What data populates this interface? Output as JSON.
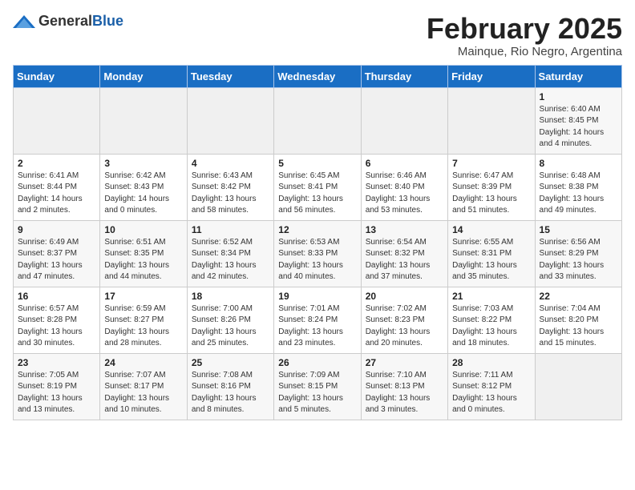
{
  "header": {
    "logo_general": "General",
    "logo_blue": "Blue",
    "month_title": "February 2025",
    "location": "Mainque, Rio Negro, Argentina"
  },
  "weekdays": [
    "Sunday",
    "Monday",
    "Tuesday",
    "Wednesday",
    "Thursday",
    "Friday",
    "Saturday"
  ],
  "weeks": [
    [
      {
        "day": "",
        "info": ""
      },
      {
        "day": "",
        "info": ""
      },
      {
        "day": "",
        "info": ""
      },
      {
        "day": "",
        "info": ""
      },
      {
        "day": "",
        "info": ""
      },
      {
        "day": "",
        "info": ""
      },
      {
        "day": "1",
        "info": "Sunrise: 6:40 AM\nSunset: 8:45 PM\nDaylight: 14 hours\nand 4 minutes."
      }
    ],
    [
      {
        "day": "2",
        "info": "Sunrise: 6:41 AM\nSunset: 8:44 PM\nDaylight: 14 hours\nand 2 minutes."
      },
      {
        "day": "3",
        "info": "Sunrise: 6:42 AM\nSunset: 8:43 PM\nDaylight: 14 hours\nand 0 minutes."
      },
      {
        "day": "4",
        "info": "Sunrise: 6:43 AM\nSunset: 8:42 PM\nDaylight: 13 hours\nand 58 minutes."
      },
      {
        "day": "5",
        "info": "Sunrise: 6:45 AM\nSunset: 8:41 PM\nDaylight: 13 hours\nand 56 minutes."
      },
      {
        "day": "6",
        "info": "Sunrise: 6:46 AM\nSunset: 8:40 PM\nDaylight: 13 hours\nand 53 minutes."
      },
      {
        "day": "7",
        "info": "Sunrise: 6:47 AM\nSunset: 8:39 PM\nDaylight: 13 hours\nand 51 minutes."
      },
      {
        "day": "8",
        "info": "Sunrise: 6:48 AM\nSunset: 8:38 PM\nDaylight: 13 hours\nand 49 minutes."
      }
    ],
    [
      {
        "day": "9",
        "info": "Sunrise: 6:49 AM\nSunset: 8:37 PM\nDaylight: 13 hours\nand 47 minutes."
      },
      {
        "day": "10",
        "info": "Sunrise: 6:51 AM\nSunset: 8:35 PM\nDaylight: 13 hours\nand 44 minutes."
      },
      {
        "day": "11",
        "info": "Sunrise: 6:52 AM\nSunset: 8:34 PM\nDaylight: 13 hours\nand 42 minutes."
      },
      {
        "day": "12",
        "info": "Sunrise: 6:53 AM\nSunset: 8:33 PM\nDaylight: 13 hours\nand 40 minutes."
      },
      {
        "day": "13",
        "info": "Sunrise: 6:54 AM\nSunset: 8:32 PM\nDaylight: 13 hours\nand 37 minutes."
      },
      {
        "day": "14",
        "info": "Sunrise: 6:55 AM\nSunset: 8:31 PM\nDaylight: 13 hours\nand 35 minutes."
      },
      {
        "day": "15",
        "info": "Sunrise: 6:56 AM\nSunset: 8:29 PM\nDaylight: 13 hours\nand 33 minutes."
      }
    ],
    [
      {
        "day": "16",
        "info": "Sunrise: 6:57 AM\nSunset: 8:28 PM\nDaylight: 13 hours\nand 30 minutes."
      },
      {
        "day": "17",
        "info": "Sunrise: 6:59 AM\nSunset: 8:27 PM\nDaylight: 13 hours\nand 28 minutes."
      },
      {
        "day": "18",
        "info": "Sunrise: 7:00 AM\nSunset: 8:26 PM\nDaylight: 13 hours\nand 25 minutes."
      },
      {
        "day": "19",
        "info": "Sunrise: 7:01 AM\nSunset: 8:24 PM\nDaylight: 13 hours\nand 23 minutes."
      },
      {
        "day": "20",
        "info": "Sunrise: 7:02 AM\nSunset: 8:23 PM\nDaylight: 13 hours\nand 20 minutes."
      },
      {
        "day": "21",
        "info": "Sunrise: 7:03 AM\nSunset: 8:22 PM\nDaylight: 13 hours\nand 18 minutes."
      },
      {
        "day": "22",
        "info": "Sunrise: 7:04 AM\nSunset: 8:20 PM\nDaylight: 13 hours\nand 15 minutes."
      }
    ],
    [
      {
        "day": "23",
        "info": "Sunrise: 7:05 AM\nSunset: 8:19 PM\nDaylight: 13 hours\nand 13 minutes."
      },
      {
        "day": "24",
        "info": "Sunrise: 7:07 AM\nSunset: 8:17 PM\nDaylight: 13 hours\nand 10 minutes."
      },
      {
        "day": "25",
        "info": "Sunrise: 7:08 AM\nSunset: 8:16 PM\nDaylight: 13 hours\nand 8 minutes."
      },
      {
        "day": "26",
        "info": "Sunrise: 7:09 AM\nSunset: 8:15 PM\nDaylight: 13 hours\nand 5 minutes."
      },
      {
        "day": "27",
        "info": "Sunrise: 7:10 AM\nSunset: 8:13 PM\nDaylight: 13 hours\nand 3 minutes."
      },
      {
        "day": "28",
        "info": "Sunrise: 7:11 AM\nSunset: 8:12 PM\nDaylight: 13 hours\nand 0 minutes."
      },
      {
        "day": "",
        "info": ""
      }
    ]
  ]
}
